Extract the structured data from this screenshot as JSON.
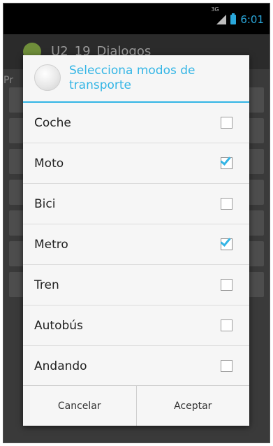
{
  "status_bar": {
    "time": "6:01",
    "signal_label": "3G"
  },
  "app_bar": {
    "title": "U2_19_Dialogos"
  },
  "background": {
    "partial_text": "Pr"
  },
  "dialog": {
    "title": "Selecciona modos de transporte",
    "options": [
      {
        "label": "Coche",
        "checked": false
      },
      {
        "label": "Moto",
        "checked": true
      },
      {
        "label": "Bici",
        "checked": false
      },
      {
        "label": "Metro",
        "checked": true
      },
      {
        "label": "Tren",
        "checked": false
      },
      {
        "label": "Autobús",
        "checked": false
      },
      {
        "label": "Andando",
        "checked": false
      }
    ],
    "buttons": {
      "cancel": "Cancelar",
      "accept": "Aceptar"
    }
  },
  "colors": {
    "accent": "#33b5e5"
  }
}
